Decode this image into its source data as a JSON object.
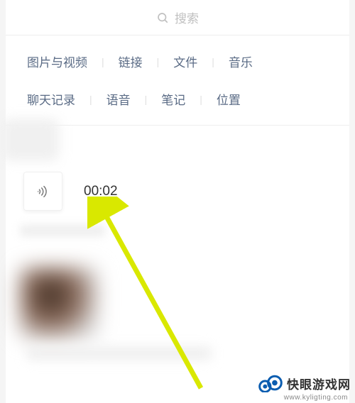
{
  "search": {
    "placeholder": "搜索"
  },
  "tabs": {
    "row1": [
      {
        "label": "图片与视频"
      },
      {
        "label": "链接"
      },
      {
        "label": "文件"
      },
      {
        "label": "音乐"
      }
    ],
    "row2": [
      {
        "label": "聊天记录"
      },
      {
        "label": "语音"
      },
      {
        "label": "笔记"
      },
      {
        "label": "位置"
      }
    ]
  },
  "voice": {
    "duration": "00:02"
  },
  "watermark": {
    "brand": "快眼游戏网",
    "url": "www.kyligting.com"
  },
  "colors": {
    "accent": "#5a6b85",
    "arrow": "#d9e800",
    "logo": "#0b5db0"
  }
}
